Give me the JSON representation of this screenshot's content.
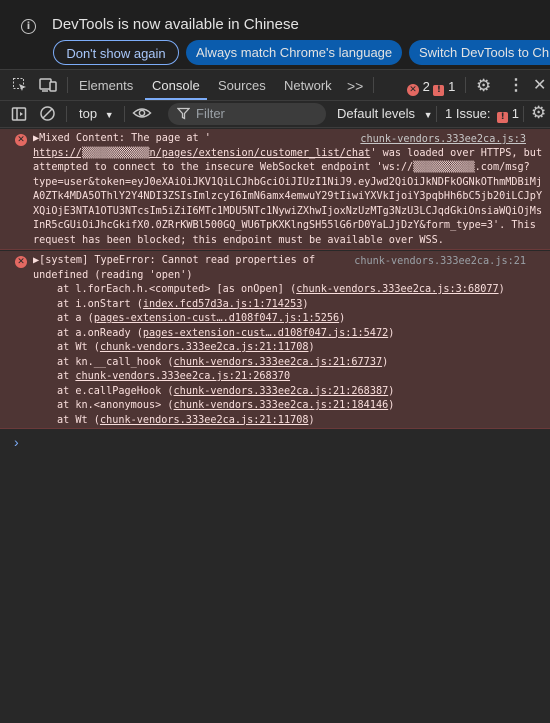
{
  "banner": {
    "title": "DevTools is now available in Chinese",
    "btn_dont_show": "Don't show again",
    "btn_always_match": "Always match Chrome's language",
    "btn_switch": "Switch DevTools to Ch"
  },
  "tabs": {
    "elements": "Elements",
    "console": "Console",
    "sources": "Sources",
    "network": "Network",
    "more": ">>"
  },
  "counts": {
    "errors": "2",
    "issues_flag": "1"
  },
  "toolbar": {
    "context": "top",
    "filter_placeholder": "Filter",
    "levels": "Default levels",
    "issues_label": "1 Issue:",
    "issues_count": "1"
  },
  "msg1": {
    "source": "chunk-vendors.333ee2ca.js:3",
    "lines": [
      "▶Mixed Content: The page at '",
      "https://▒▒▒▒▒▒▒▒▒▒▒n/pages/extension/customer_list/chat",
      "' was loaded over HTTPS, but",
      "attempted to connect to the insecure WebSocket endpoint 'ws://▒▒▒▒▒▒▒▒▒▒.com/msg?",
      "type=user&token=eyJ0eXAiOiJKV1QiLCJhbGciOiJIUzI1NiJ9.eyJwd2QiOiJkNDFkOGNkOThmMDBiMj",
      "A0ZTk4MDA5OThlY2Y4NDI3ZSIsImlzcyI6ImN6amx4emwuY29tIiwiYXVkIjoiY3pqbHh6bC5jb20iLCJpY",
      "XQiOjE3NTA1OTU3NTcsIm5iZiI6MTc1MDU5NTc1NywiZXhwIjoxNzUzMTg3NzU3LCJqdGkiOnsiaWQiOjMs",
      "InR5cGUiOiJhcGkifX0.0ZRrKWBl500GQ_WU6TpKXKlngSH55lG6rD0YaLJjDzY&form_type=3'. This",
      "request has been blocked; this endpoint must be available over WSS."
    ]
  },
  "msg2": {
    "source": "chunk-vendors.333ee2ca.js:21",
    "head1": "▶[system] TypeError: Cannot read properties of",
    "head2": "undefined (reading 'open')",
    "stack": [
      {
        "pre": "at l.forEach.h.<computed> [as onOpen] (",
        "link": "chunk-vendors.333ee2ca.js:3:68077",
        "post": ")"
      },
      {
        "pre": "at i.onStart (",
        "link": "index.fcd57d3a.js:1:714253",
        "post": ")"
      },
      {
        "pre": "at a (",
        "link": "pages-extension-cust….d108f047.js:1:5256",
        "post": ")"
      },
      {
        "pre": "at a.onReady (",
        "link": "pages-extension-cust….d108f047.js:1:5472",
        "post": ")"
      },
      {
        "pre": "at Wt (",
        "link": "chunk-vendors.333ee2ca.js:21:11708",
        "post": ")"
      },
      {
        "pre": "at kn.__call_hook (",
        "link": "chunk-vendors.333ee2ca.js:21:67737",
        "post": ")"
      },
      {
        "pre": "at ",
        "link": "chunk-vendors.333ee2ca.js:21:268370",
        "post": ""
      },
      {
        "pre": "at e.callPageHook (",
        "link": "chunk-vendors.333ee2ca.js:21:268387",
        "post": ")"
      },
      {
        "pre": "at kn.<anonymous> (",
        "link": "chunk-vendors.333ee2ca.js:21:184146",
        "post": ")"
      },
      {
        "pre": "at Wt (",
        "link": "chunk-vendors.333ee2ca.js:21:11708",
        "post": ")"
      }
    ]
  }
}
